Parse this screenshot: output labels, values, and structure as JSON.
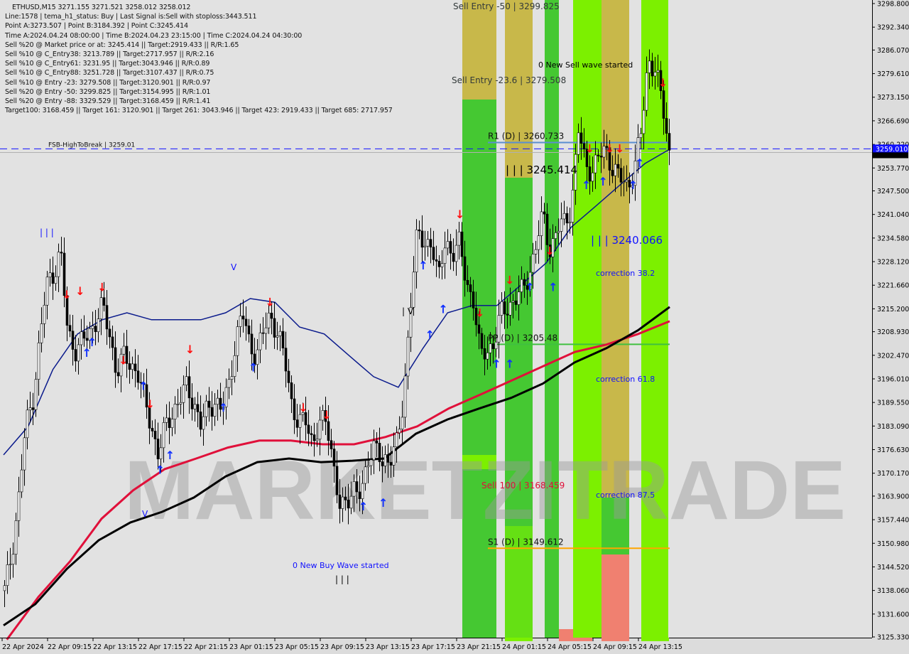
{
  "header": {
    "title": "ETHUSD,M15  3271.155 3271.521 3258.012 3258.012",
    "lines": [
      "Line:1578 | tema_h1_status: Buy | Last Signal is:Sell with stoploss:3443.511",
      "Point A:3273.507 | Point B:3184.392 | Point C:3245.414",
      "Time A:2024.04.24 08:00:00 | Time B:2024.04.23 23:15:00 | Time C:2024.04.24 04:30:00",
      "Sell %20 @ Market price or at: 3245.414 || Target:2919.433 || R/R:1.65",
      "Sell %10 @ C_Entry38: 3213.789 || Target:2717.957 || R/R:2.16",
      "Sell %10 @ C_Entry61: 3231.95 || Target:3043.946 || R/R:0.89",
      "Sell %10 @ C_Entry88: 3251.728 || Target:3107.437 || R/R:0.75",
      "Sell %10 @ Entry -23: 3279.508 || Target:3120.901 || R/R:0.97",
      "Sell %20 @ Entry -50: 3299.825 || Target:3154.995 || R/R:1.01",
      "Sell %20 @ Entry -88: 3329.529 || Target:3168.459 || R/R:1.41",
      "Target100: 3168.459 || Target 161: 3120.901 || Target 261: 3043.946 || Target 423: 2919.433 || Target 685: 2717.957"
    ]
  },
  "watermark": "MARKETZITRADE",
  "colors": {
    "background": "#e2e2e2",
    "bull_candle": "#ffffff",
    "bear_candle": "#000000",
    "ma_fast": "#0a1a8c",
    "ma_mid": "#e0103a",
    "ma_slow": "#000000",
    "zone_green": "#45c832",
    "zone_lime": "#7cf000",
    "zone_khaki": "#c8b84a",
    "zone_salmon": "#f08070",
    "fsb_line": "#1010ff",
    "r1_line": "#5a8ed0",
    "pp_line": "#40c040",
    "s1_line": "#ffa500",
    "current_price_bg": "#1010ff",
    "bid_bg": "#000000"
  },
  "chart_data": {
    "type": "candlestick",
    "symbol": "ETHUSD",
    "timeframe": "M15",
    "ylim": [
      3125.33,
      3298.8
    ],
    "y_ticks": [
      3298.8,
      3292.34,
      3286.07,
      3279.61,
      3273.15,
      3266.69,
      3260.22,
      3253.77,
      3247.5,
      3241.04,
      3234.58,
      3228.12,
      3221.66,
      3215.2,
      3208.93,
      3202.47,
      3196.01,
      3189.55,
      3183.09,
      3176.63,
      3170.17,
      3163.9,
      3157.44,
      3150.98,
      3144.52,
      3138.06,
      3131.6,
      3125.33
    ],
    "y_tick_labels": [
      "3298.800",
      "3292.340",
      "3286.070",
      "3279.610",
      "3273.150",
      "3266.690",
      "3260.220",
      "3253.770",
      "3247.500",
      "3241.040",
      "3234.580",
      "3228.120",
      "3221.660",
      "3215.200",
      "3208.930",
      "3202.470",
      "3196.010",
      "3189.550",
      "3183.090",
      "3176.630",
      "3170.170",
      "3163.900",
      "3157.440",
      "3150.980",
      "3144.520",
      "3138.060",
      "3131.600",
      "3125.330"
    ],
    "x_tick_labels": [
      "22 Apr 2024",
      "22 Apr 09:15",
      "22 Apr 13:15",
      "22 Apr 17:15",
      "22 Apr 21:15",
      "23 Apr 01:15",
      "23 Apr 05:15",
      "23 Apr 09:15",
      "23 Apr 13:15",
      "23 Apr 17:15",
      "23 Apr 21:15",
      "24 Apr 01:15",
      "24 Apr 05:15",
      "24 Apr 09:15",
      "24 Apr 13:15"
    ],
    "price_path": [
      3138,
      3148,
      3163,
      3183,
      3190,
      3206,
      3222,
      3225,
      3231,
      3209,
      3204,
      3206,
      3208,
      3212,
      3216,
      3208,
      3198,
      3202,
      3200,
      3198,
      3190,
      3183,
      3175,
      3183,
      3187,
      3190,
      3194,
      3190,
      3183,
      3188,
      3190,
      3187,
      3194,
      3206,
      3214,
      3206,
      3202,
      3209,
      3214,
      3208,
      3202,
      3190,
      3183,
      3185,
      3179,
      3183,
      3185,
      3173,
      3159,
      3163,
      3167,
      3163,
      3175,
      3179,
      3171,
      3175,
      3179,
      3187,
      3218,
      3237,
      3231,
      3235,
      3223,
      3233,
      3231,
      3233,
      3222,
      3218,
      3202,
      3204,
      3206,
      3214,
      3216,
      3218,
      3220,
      3225,
      3233,
      3241,
      3231,
      3237,
      3239,
      3243,
      3264,
      3255,
      3253,
      3257,
      3259,
      3253,
      3251,
      3249,
      3253,
      3264,
      3284,
      3280,
      3272,
      3258
    ],
    "ma_fast": [
      3175.2,
      3183.0,
      3198.6,
      3208.3,
      3212.2,
      3214.1,
      3212.2,
      3212.2,
      3212.2,
      3214.1,
      3218.0,
      3217.0,
      3210.2,
      3208.3,
      3202.4,
      3196.6,
      3193.7,
      3204.4,
      3214.1,
      3216.1,
      3216.1,
      3221.9,
      3227.8,
      3237.5,
      3243.3,
      3249.2,
      3255.0,
      3258.9
    ],
    "ma_mid": [
      3124.6,
      3136.3,
      3146.0,
      3157.7,
      3165.5,
      3171.3,
      3174.2,
      3177.2,
      3179.1,
      3179.1,
      3178.1,
      3178.1,
      3180.1,
      3183.0,
      3187.9,
      3191.7,
      3195.6,
      3199.5,
      3203.4,
      3205.4,
      3208.3,
      3211.8
    ],
    "ma_slow": [
      3128.5,
      3134.3,
      3144.0,
      3151.8,
      3156.7,
      3159.6,
      3163.5,
      3169.3,
      3173.2,
      3174.2,
      3173.2,
      3173.6,
      3174.2,
      3181.0,
      3184.9,
      3187.9,
      3190.8,
      3194.7,
      3200.5,
      3204.4,
      3209.3,
      3215.7
    ],
    "current_price": "3259.010",
    "bid_price": "3258.012",
    "levels": [
      {
        "label": "FSB-HighToBreak | 3259.01",
        "price": 3259.01,
        "style": "dashed",
        "color_key": "fsb_line",
        "from": "start"
      },
      {
        "label": "R1 (D) | 3260.733",
        "price": 3260.733,
        "style": "solid",
        "color_key": "r1_line",
        "from": "23 Apr 21:15"
      },
      {
        "label": "PP (D) | 3205.48",
        "price": 3205.48,
        "style": "solid",
        "color_key": "pp_line",
        "from": "23 Apr 21:15"
      },
      {
        "label": "S1 (D) | 3149.612",
        "price": 3149.612,
        "style": "solid",
        "color_key": "s1_line",
        "from": "23 Apr 21:15"
      }
    ],
    "annotations": [
      {
        "text": "Sell Entry -50 | 3299.825",
        "price": 3299.825,
        "color": "#333a3a"
      },
      {
        "text": "Sell Entry -23.6 | 3279.508",
        "price": 3279.508,
        "color": "#333a3a"
      },
      {
        "text": "0 New Sell wave started",
        "price": 3283,
        "color": "#000000"
      },
      {
        "text": "| | | 3245.414",
        "price": 3245.414,
        "color": "#000000"
      },
      {
        "text": "| | | 3240.066",
        "price": 3240.066,
        "color": "#1010ff"
      },
      {
        "text": "correction 38.2",
        "price": 3226,
        "color": "#1010ff"
      },
      {
        "text": "correction 61.8",
        "price": 3197,
        "color": "#1010ff"
      },
      {
        "text": "Sell 100 | 3168.459",
        "price": 3168.459,
        "color": "#e0103a"
      },
      {
        "text": "correction 87.5",
        "price": 3165,
        "color": "#1010ff"
      },
      {
        "text": "0 New Buy Wave started",
        "price": 3144,
        "color": "#1010ff"
      },
      {
        "text": "| | |",
        "price": 3234,
        "color": "#1010ff"
      },
      {
        "text": "| | |",
        "price": 3139,
        "color": "#000000"
      },
      {
        "text": "V",
        "price": 3226,
        "color": "#1010ff"
      },
      {
        "text": "V",
        "price": 3159,
        "color": "#1010ff"
      },
      {
        "text": "| V",
        "price": 3215,
        "color": "#000000"
      }
    ],
    "signals": [
      {
        "type": "sell",
        "at": 0.095,
        "price": 3218
      },
      {
        "type": "sell",
        "at": 0.115,
        "price": 3219
      },
      {
        "type": "sell",
        "at": 0.148,
        "price": 3220
      },
      {
        "type": "sell",
        "at": 0.18,
        "price": 3200
      },
      {
        "type": "sell",
        "at": 0.22,
        "price": 3188
      },
      {
        "type": "sell",
        "at": 0.28,
        "price": 3203
      },
      {
        "type": "sell",
        "at": 0.4,
        "price": 3216
      },
      {
        "type": "sell",
        "at": 0.45,
        "price": 3187
      },
      {
        "type": "sell",
        "at": 0.485,
        "price": 3185
      },
      {
        "type": "sell",
        "at": 0.685,
        "price": 3240
      },
      {
        "type": "sell",
        "at": 0.715,
        "price": 3213
      },
      {
        "type": "sell",
        "at": 0.76,
        "price": 3222
      },
      {
        "type": "sell",
        "at": 0.82,
        "price": 3230
      },
      {
        "type": "sell",
        "at": 0.88,
        "price": 3258
      },
      {
        "type": "sell",
        "at": 0.91,
        "price": 3258
      },
      {
        "type": "sell",
        "at": 0.925,
        "price": 3258
      },
      {
        "type": "sell",
        "at": 0.99,
        "price": 3276
      },
      {
        "type": "buy",
        "at": 0.125,
        "price": 3202
      },
      {
        "type": "buy",
        "at": 0.133,
        "price": 3205
      },
      {
        "type": "buy",
        "at": 0.21,
        "price": 3193
      },
      {
        "type": "buy",
        "at": 0.235,
        "price": 3170
      },
      {
        "type": "buy",
        "at": 0.25,
        "price": 3174
      },
      {
        "type": "buy",
        "at": 0.33,
        "price": 3187
      },
      {
        "type": "buy",
        "at": 0.375,
        "price": 3198
      },
      {
        "type": "buy",
        "at": 0.54,
        "price": 3160
      },
      {
        "type": "buy",
        "at": 0.57,
        "price": 3161
      },
      {
        "type": "buy",
        "at": 0.63,
        "price": 3226
      },
      {
        "type": "buy",
        "at": 0.66,
        "price": 3214
      },
      {
        "type": "buy",
        "at": 0.64,
        "price": 3207
      },
      {
        "type": "buy",
        "at": 0.74,
        "price": 3199
      },
      {
        "type": "buy",
        "at": 0.76,
        "price": 3199
      },
      {
        "type": "buy",
        "at": 0.79,
        "price": 3220
      },
      {
        "type": "buy",
        "at": 0.825,
        "price": 3220
      },
      {
        "type": "buy",
        "at": 0.875,
        "price": 3248
      },
      {
        "type": "buy",
        "at": 0.9,
        "price": 3249
      },
      {
        "type": "buy",
        "at": 0.945,
        "price": 3248
      },
      {
        "type": "buy",
        "at": 0.955,
        "price": 3254
      }
    ]
  }
}
